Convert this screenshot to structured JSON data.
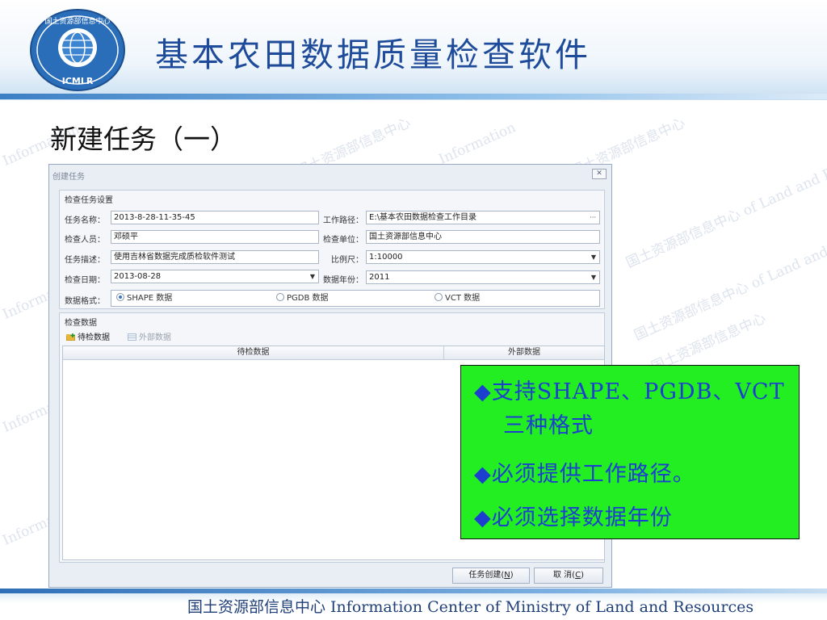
{
  "slide": {
    "title": "基本农田数据质量检查软件",
    "subtitle": "新建任务（一）",
    "logo_text": "国土资源部信息中心",
    "logo_abbr": "ICMLR",
    "footer": "国土资源部信息中心 Information Center of Ministry of Land and Resources"
  },
  "watermark": {
    "lines": [
      "Information Center of Ministry of Land and Resources",
      "国土资源部信息中心",
      "Information",
      "国土资源部信息中心 of Land and Resources"
    ]
  },
  "dialog": {
    "title": "创建任务",
    "close": "✕",
    "settings": {
      "group_title": "检查任务设置",
      "task_name_label": "任务名称：",
      "task_name": "2013-8-28-11-35-45",
      "work_path_label": "工作路径：",
      "work_path": "E:\\基本农田数据检查工作目录",
      "work_path_button": "···",
      "inspector_label": "检查人员：",
      "inspector": "邓硕平",
      "unit_label": "检查单位：",
      "unit": "国土资源部信息中心",
      "desc_label": "任务描述：",
      "desc": "使用吉林省数据完成质检软件测试",
      "scale_label": "比例尺：",
      "scale": "1:10000",
      "date_label": "检查日期：",
      "date": "2013-08-28",
      "year_label": "数据年份：",
      "year": "2011",
      "format_label": "数据格式：",
      "formats": [
        "SHAPE 数据",
        "PGDB 数据",
        "VCT 数据"
      ],
      "format_selected": "SHAPE 数据"
    },
    "data": {
      "group_title": "检查数据",
      "tab_pending": "待检数据",
      "tab_external": "外部数据",
      "col_pending": "待检数据",
      "col_external": "外部数据"
    },
    "buttons": {
      "create": "任务创建(N)",
      "create_prefix": "任务创建(",
      "create_key": "N",
      "create_suffix": ")",
      "cancel": "取 消(C)",
      "cancel_prefix": "取 消(",
      "cancel_key": "C",
      "cancel_suffix": ")"
    }
  },
  "callout": {
    "bullet": "◆",
    "lines": [
      "支持SHAPE、PGDB、VCT",
      "三种格式",
      "必须提供工作路径。",
      "必须选择数据年份"
    ]
  },
  "colors": {
    "title_blue": "#1f4c9a",
    "callout_green": "#22ee22",
    "callout_text": "#1c3fd0"
  }
}
